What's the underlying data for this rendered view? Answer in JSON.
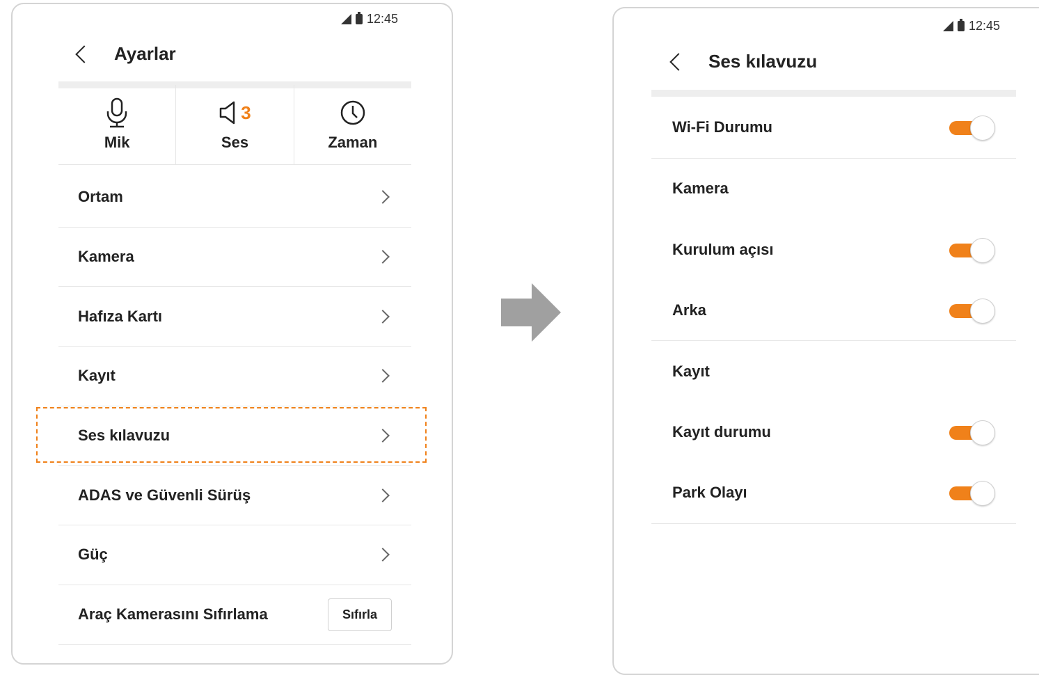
{
  "left_screen": {
    "status_time": "12:45",
    "title": "Ayarlar",
    "quick_tabs": [
      {
        "label": "Mik",
        "icon": "microphone-icon"
      },
      {
        "label": "Ses",
        "icon": "speaker-icon",
        "badge": "3"
      },
      {
        "label": "Zaman",
        "icon": "clock-icon"
      }
    ],
    "menu": [
      {
        "label": "Ortam"
      },
      {
        "label": "Kamera"
      },
      {
        "label": "Hafıza Kartı"
      },
      {
        "label": "Kayıt"
      },
      {
        "label": "Ses kılavuzu",
        "highlighted": true
      },
      {
        "label": "ADAS ve Güvenli Sürüş"
      },
      {
        "label": "Güç"
      }
    ],
    "reset_row": {
      "label": "Araç Kamerasını Sıfırlama",
      "button": "Sıfırla"
    }
  },
  "right_screen": {
    "status_time": "12:45",
    "title": "Ses kılavuzu",
    "rows": [
      {
        "label": "Wi-Fi Durumu",
        "toggle": true
      },
      {
        "label": "Kamera"
      },
      {
        "label": "Kurulum açısı",
        "toggle": true
      },
      {
        "label": "Arka",
        "toggle": true
      },
      {
        "label": "Kayıt"
      },
      {
        "label": "Kayıt durumu",
        "toggle": true
      },
      {
        "label": "Park Olayı",
        "toggle": true
      }
    ]
  },
  "colors": {
    "accent": "#f0811a",
    "divider": "#e6e6e6",
    "arrow": "#a0a0a0"
  }
}
